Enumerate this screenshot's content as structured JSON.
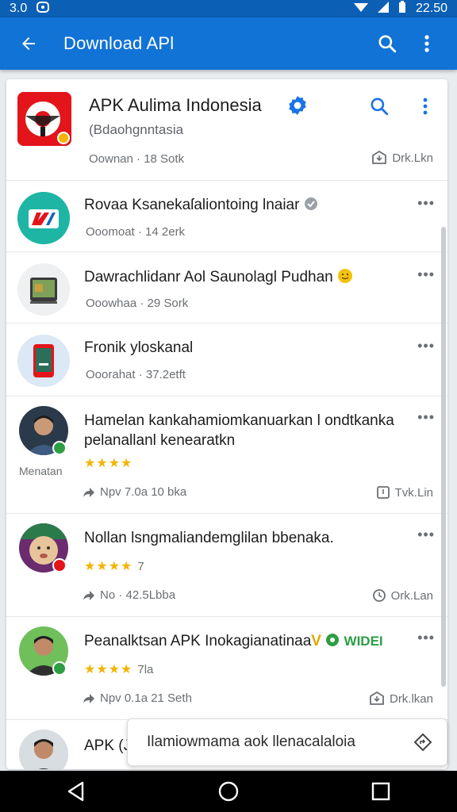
{
  "status_bar": {
    "left_text": "3.0",
    "time": "22.50"
  },
  "app_bar": {
    "title": "Download APl"
  },
  "top_card": {
    "name": "APK Aulima Indonesia",
    "subtitle": "(Bdaohgnntasia",
    "meta": "Oownan · 18 Sotk",
    "download_label": "Drk.Lkn"
  },
  "rows": [
    {
      "title": "Rovaa Ksanekaſaliontoing lnaiar",
      "meta": "Ooomoat · 14 2erk"
    },
    {
      "title": "Dawrachlidanr Aol Saunolagl Pudhan",
      "meta": "Ooowhaa · 29 Sork"
    },
    {
      "title": "Fronik yloskanal",
      "meta": "Ooorahat · 37.2etft"
    }
  ],
  "feed": [
    {
      "title": "Hamelan kankahamiomkanuarkan l ondtkanka pelanallanl kenearatkn",
      "stars": "★★★★",
      "rating": "",
      "user": "Menatan",
      "meta": "Npv 7.0a 10 bka",
      "action": "Tvk.Lin"
    },
    {
      "title": "Nollan lsngmaliandemglilan bbenaka.",
      "stars": "★★★★",
      "rating": "7",
      "meta": "No · 42.5Lbba",
      "action": "Ork.Lan"
    },
    {
      "title": "Peanalktsan APK Inokagianatinaa",
      "v": "V",
      "tag": "WIDEI",
      "stars": "★★★★",
      "rating": "7la",
      "meta": "Npv 0.1a 21 Seth",
      "action": "Drk.lkan"
    },
    {
      "title": "APK (J"
    }
  ],
  "toast": {
    "text": "Ilamiowmama aok llenacalaloia"
  },
  "colors": {
    "primary": "#1273d6",
    "status": "#0b5fb5",
    "star": "#f4b400",
    "verified": "#1a73e8",
    "green": "#2e9e44"
  }
}
